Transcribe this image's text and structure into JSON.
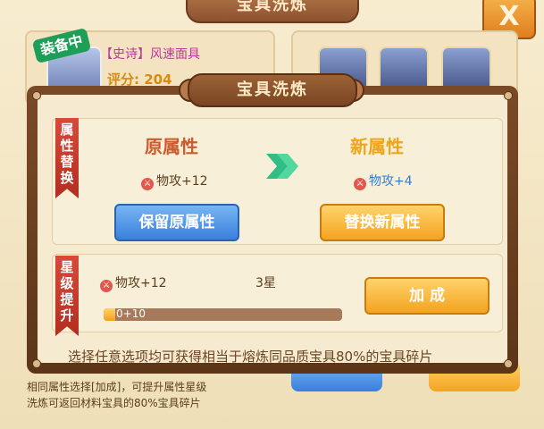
{
  "background": {
    "title": "宝具洗炼",
    "close_label": "X",
    "equipped_badge": "装备中",
    "item_name": "【史诗】风速面具",
    "score": "评分: 204",
    "note_line1": "相同属性选择[加成]，可提升属性星级",
    "note_line2": "洗炼可返回材料宝具的80%宝具碎片"
  },
  "modal": {
    "title": "宝具洗炼",
    "replace_section": {
      "ribbon": "属性替换",
      "old_header": "原属性",
      "new_header": "新属性",
      "old_attr": "物攻+12",
      "new_attr": "物攻+4",
      "keep_button": "保留原属性",
      "replace_button": "替换新属性"
    },
    "star_section": {
      "ribbon": "星级提升",
      "attr": "物攻+12",
      "stars": "3星",
      "add_button": "加  成",
      "progress_text": "0+10",
      "progress_fraction": 0.0
    },
    "note": "选择任意选项均可获得相当于熔炼同品质宝具80%的宝具碎片"
  },
  "colors": {
    "accent_red": "#d84a3a",
    "accent_orange": "#f0a418",
    "accent_blue": "#3a7fdc",
    "attr_blue": "#2c7fd8"
  }
}
